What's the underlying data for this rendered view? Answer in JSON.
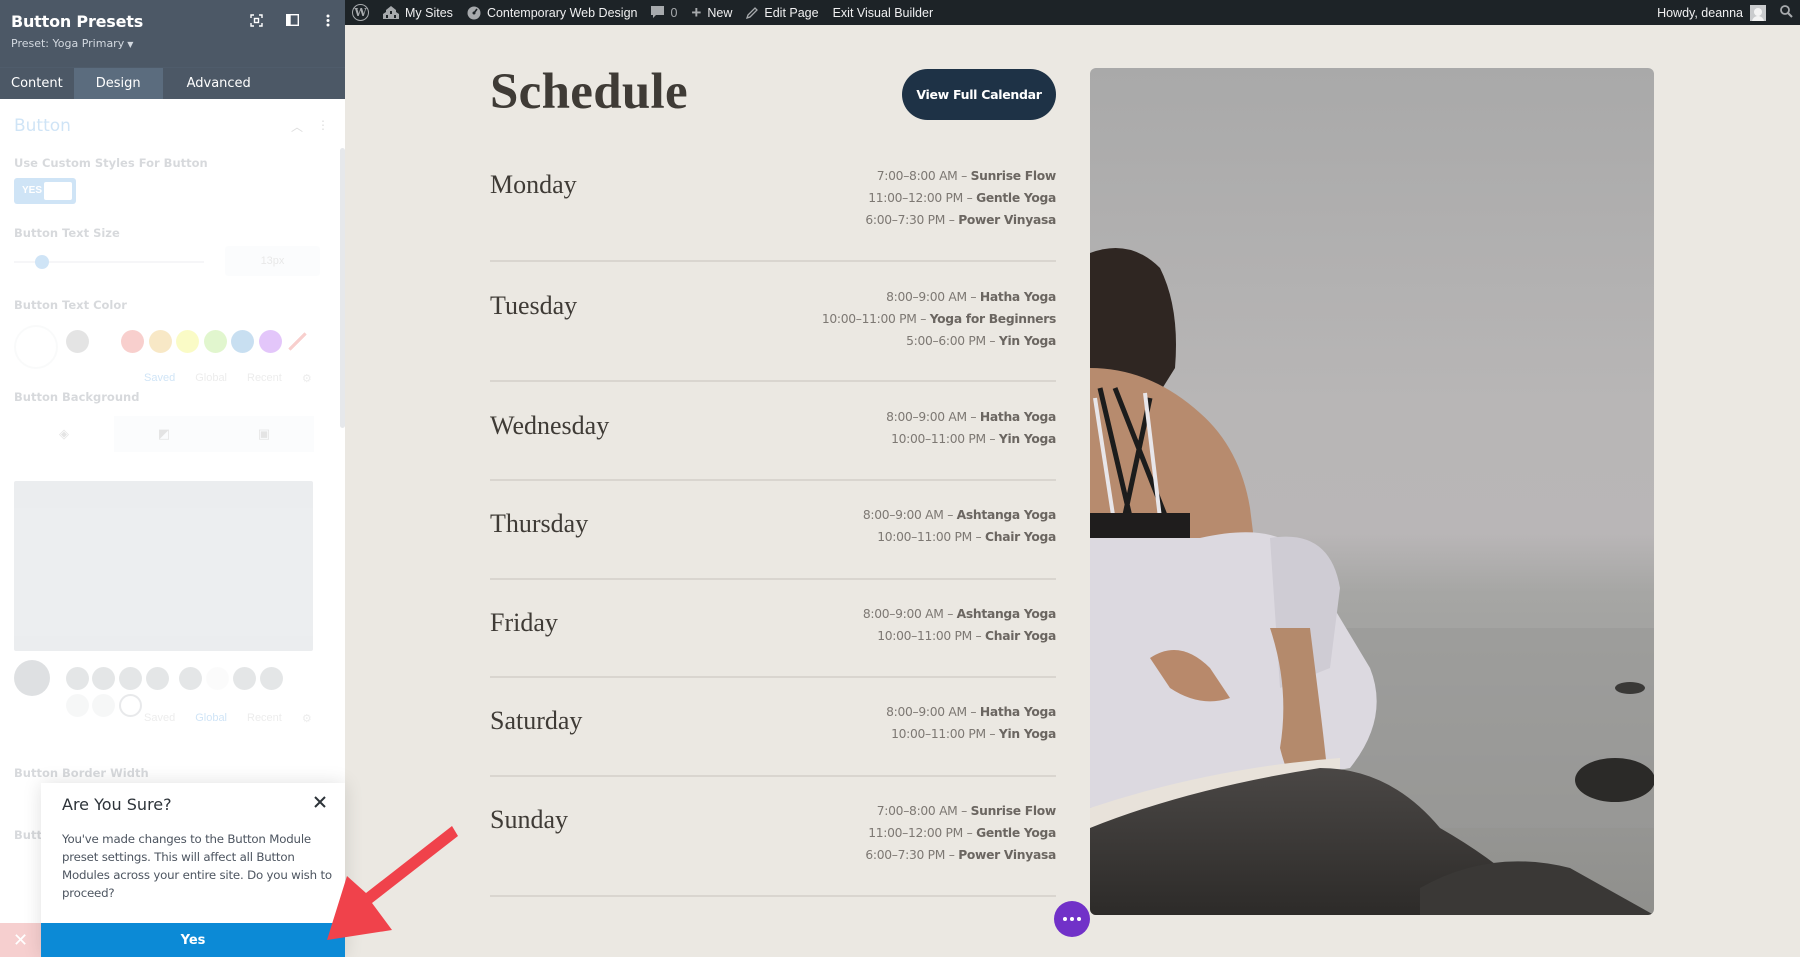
{
  "admin_bar": {
    "items": [
      {
        "icon": "wordpress-logo-icon",
        "label": ""
      },
      {
        "icon": "my-sites-icon",
        "label": "My Sites"
      },
      {
        "icon": "dashboard-icon",
        "label": "Contemporary Web Design"
      },
      {
        "icon": "comment-icon",
        "label": "0"
      },
      {
        "icon": "plus-icon",
        "label": "New"
      },
      {
        "icon": "pencil-icon",
        "label": "Edit Page"
      },
      {
        "icon": "",
        "label": "Exit Visual Builder"
      }
    ],
    "greeting": "Howdy, deanna",
    "search_icon": "search-icon"
  },
  "sidebar": {
    "title": "Button Presets",
    "preset": "Preset: Yoga Primary",
    "header_icons": [
      "focus-icon",
      "layout-icon",
      "more-vertical-icon"
    ],
    "tabs": [
      {
        "label": "Content",
        "active": false
      },
      {
        "label": "Design",
        "active": true
      },
      {
        "label": "Advanced",
        "active": false
      }
    ],
    "section_title": "Button",
    "fields": {
      "custom_styles_label": "Use Custom Styles For Button",
      "custom_styles_value": "YES",
      "text_size_label": "Button Text Size",
      "text_size_value": "13px",
      "text_color_label": "Button Text Color",
      "color_tabs": [
        "Saved",
        "Global",
        "Recent"
      ],
      "background_label": "Button Background",
      "background_color_tabs": [
        "Saved",
        "Global",
        "Recent"
      ],
      "border_width_label": "Button Border Width",
      "truncated_label": "Butt"
    },
    "swatches": [
      "#8a8a8a",
      "#ffffff",
      "#e02b20",
      "#e09900",
      "#edf000",
      "#7cda24",
      "#0c71c3",
      "#8300e9"
    ]
  },
  "page": {
    "title": "Schedule",
    "cta_button": "View Full Calendar",
    "days": [
      {
        "name": "Monday",
        "classes": [
          {
            "time": "7:00–8:00 AM",
            "name": "Sunrise Flow"
          },
          {
            "time": "11:00–12:00 PM",
            "name": "Gentle Yoga"
          },
          {
            "time": "6:00–7:30 PM",
            "name": "Power Vinyasa"
          }
        ]
      },
      {
        "name": "Tuesday",
        "classes": [
          {
            "time": "8:00–9:00 AM",
            "name": "Hatha Yoga"
          },
          {
            "time": "10:00–11:00 PM",
            "name": "Yoga for Beginners"
          },
          {
            "time": "5:00–6:00 PM",
            "name": "Yin Yoga"
          }
        ]
      },
      {
        "name": "Wednesday",
        "classes": [
          {
            "time": "8:00–9:00 AM",
            "name": "Hatha Yoga"
          },
          {
            "time": "10:00–11:00 PM",
            "name": "Yin Yoga"
          }
        ]
      },
      {
        "name": "Thursday",
        "classes": [
          {
            "time": "8:00–9:00 AM",
            "name": "Ashtanga Yoga"
          },
          {
            "time": "10:00–11:00 PM",
            "name": "Chair Yoga"
          }
        ]
      },
      {
        "name": "Friday",
        "classes": [
          {
            "time": "8:00–9:00 AM",
            "name": "Ashtanga Yoga"
          },
          {
            "time": "10:00–11:00 PM",
            "name": "Chair Yoga"
          }
        ]
      },
      {
        "name": "Saturday",
        "classes": [
          {
            "time": "8:00–9:00 AM",
            "name": "Hatha Yoga"
          },
          {
            "time": "10:00–11:00 PM",
            "name": "Yin Yoga"
          }
        ]
      },
      {
        "name": "Sunday",
        "classes": [
          {
            "time": "7:00–8:00 AM",
            "name": "Sunrise Flow"
          },
          {
            "time": "11:00–12:00 PM",
            "name": "Gentle Yoga"
          },
          {
            "time": "6:00–7:30 PM",
            "name": "Power Vinyasa"
          }
        ]
      }
    ],
    "separator": "–",
    "photo_alt": "Woman in white doing yoga on a rock by the sea"
  },
  "dialog": {
    "title": "Are You Sure?",
    "message": "You've made changes to the Button Module preset settings. This will affect all Button Modules across your entire site. Do you wish to proceed?",
    "confirm_label": "Yes"
  },
  "colors": {
    "accent": "#0c8ad6",
    "cta": "#1e3246",
    "fab": "#7131c8",
    "annotation_arrow": "#f0424b"
  }
}
